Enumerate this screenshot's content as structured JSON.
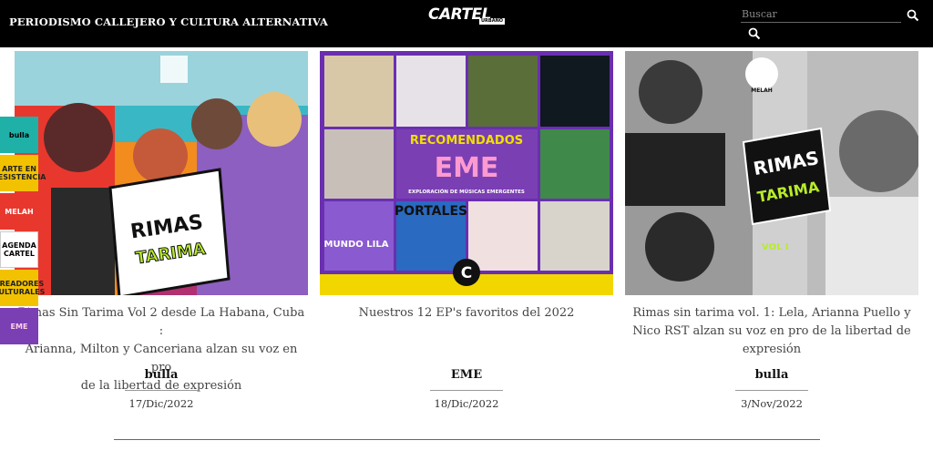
{
  "header": {
    "tagline": "PERIODISMO CALLEJERO Y CULTURA ALTERNATIVA",
    "logo_main": "CARTEL",
    "logo_sub": "URBANO",
    "search_placeholder": "Buscar",
    "search_icon": "search-icon"
  },
  "side_menu": [
    {
      "label": "bulla",
      "bg": "#1fb1a8",
      "fg": "#000000"
    },
    {
      "label": "ARTE EN RESISTENCIA",
      "bg": "#f2c200",
      "fg": "#222222"
    },
    {
      "label": "MELAH",
      "bg": "#e8382e",
      "fg": "#ffffff"
    },
    {
      "label": "AGENDA CARTEL",
      "bg": "#ffffff",
      "fg": "#000000"
    },
    {
      "label": "CREADORES CULTURALES",
      "bg": "#f2c200",
      "fg": "#222222"
    },
    {
      "label": "EME",
      "bg": "#7a3fb3",
      "fg": "#ffcfe8"
    }
  ],
  "cards": [
    {
      "title": "Rimas Sin Tarima Vol 2 desde La Habana, Cuba : Arianna, Milton y Canceriana alzan su voz en pro de la libertad de expresión",
      "title_visible_lines": [
        "Rimas Sin Tarima Vol 2 desde La Habana, Cuba :",
        "Arianna, Milton y Canceriana alzan su voz en pro",
        "de la libertad de expresión"
      ],
      "category": "bulla",
      "date": "17/Dic/2022",
      "image_text": "RIMAS SIN TARIMA"
    },
    {
      "title": "Nuestros 12 EP's favoritos del 2022",
      "category": "EME",
      "date": "18/Dic/2022",
      "image_text_1": "RECOMENDADOS",
      "image_text_2": "EME",
      "image_text_3": "EXPLORACIÓN DE MÚSICAS EMERGENTES",
      "image_text_4": "PORTALES",
      "image_text_5": "MUNDO LILA"
    },
    {
      "title": "Rimas sin tarima vol. 1: Lela, Arianna Puello y Nico RST alzan su voz en pro de la libertad de expresión",
      "title_visible_lines": [
        "Rimas sin tarima vol. 1: Lela, Arianna Puello y",
        "Nico RST alzan su voz en pro de la libertad de",
        "expresión"
      ],
      "category": "bulla",
      "date": "3/Nov/2022",
      "image_text": "RIMAS SIN TARIMA",
      "image_badge": "VOL I",
      "image_logo": "MELAH"
    }
  ]
}
